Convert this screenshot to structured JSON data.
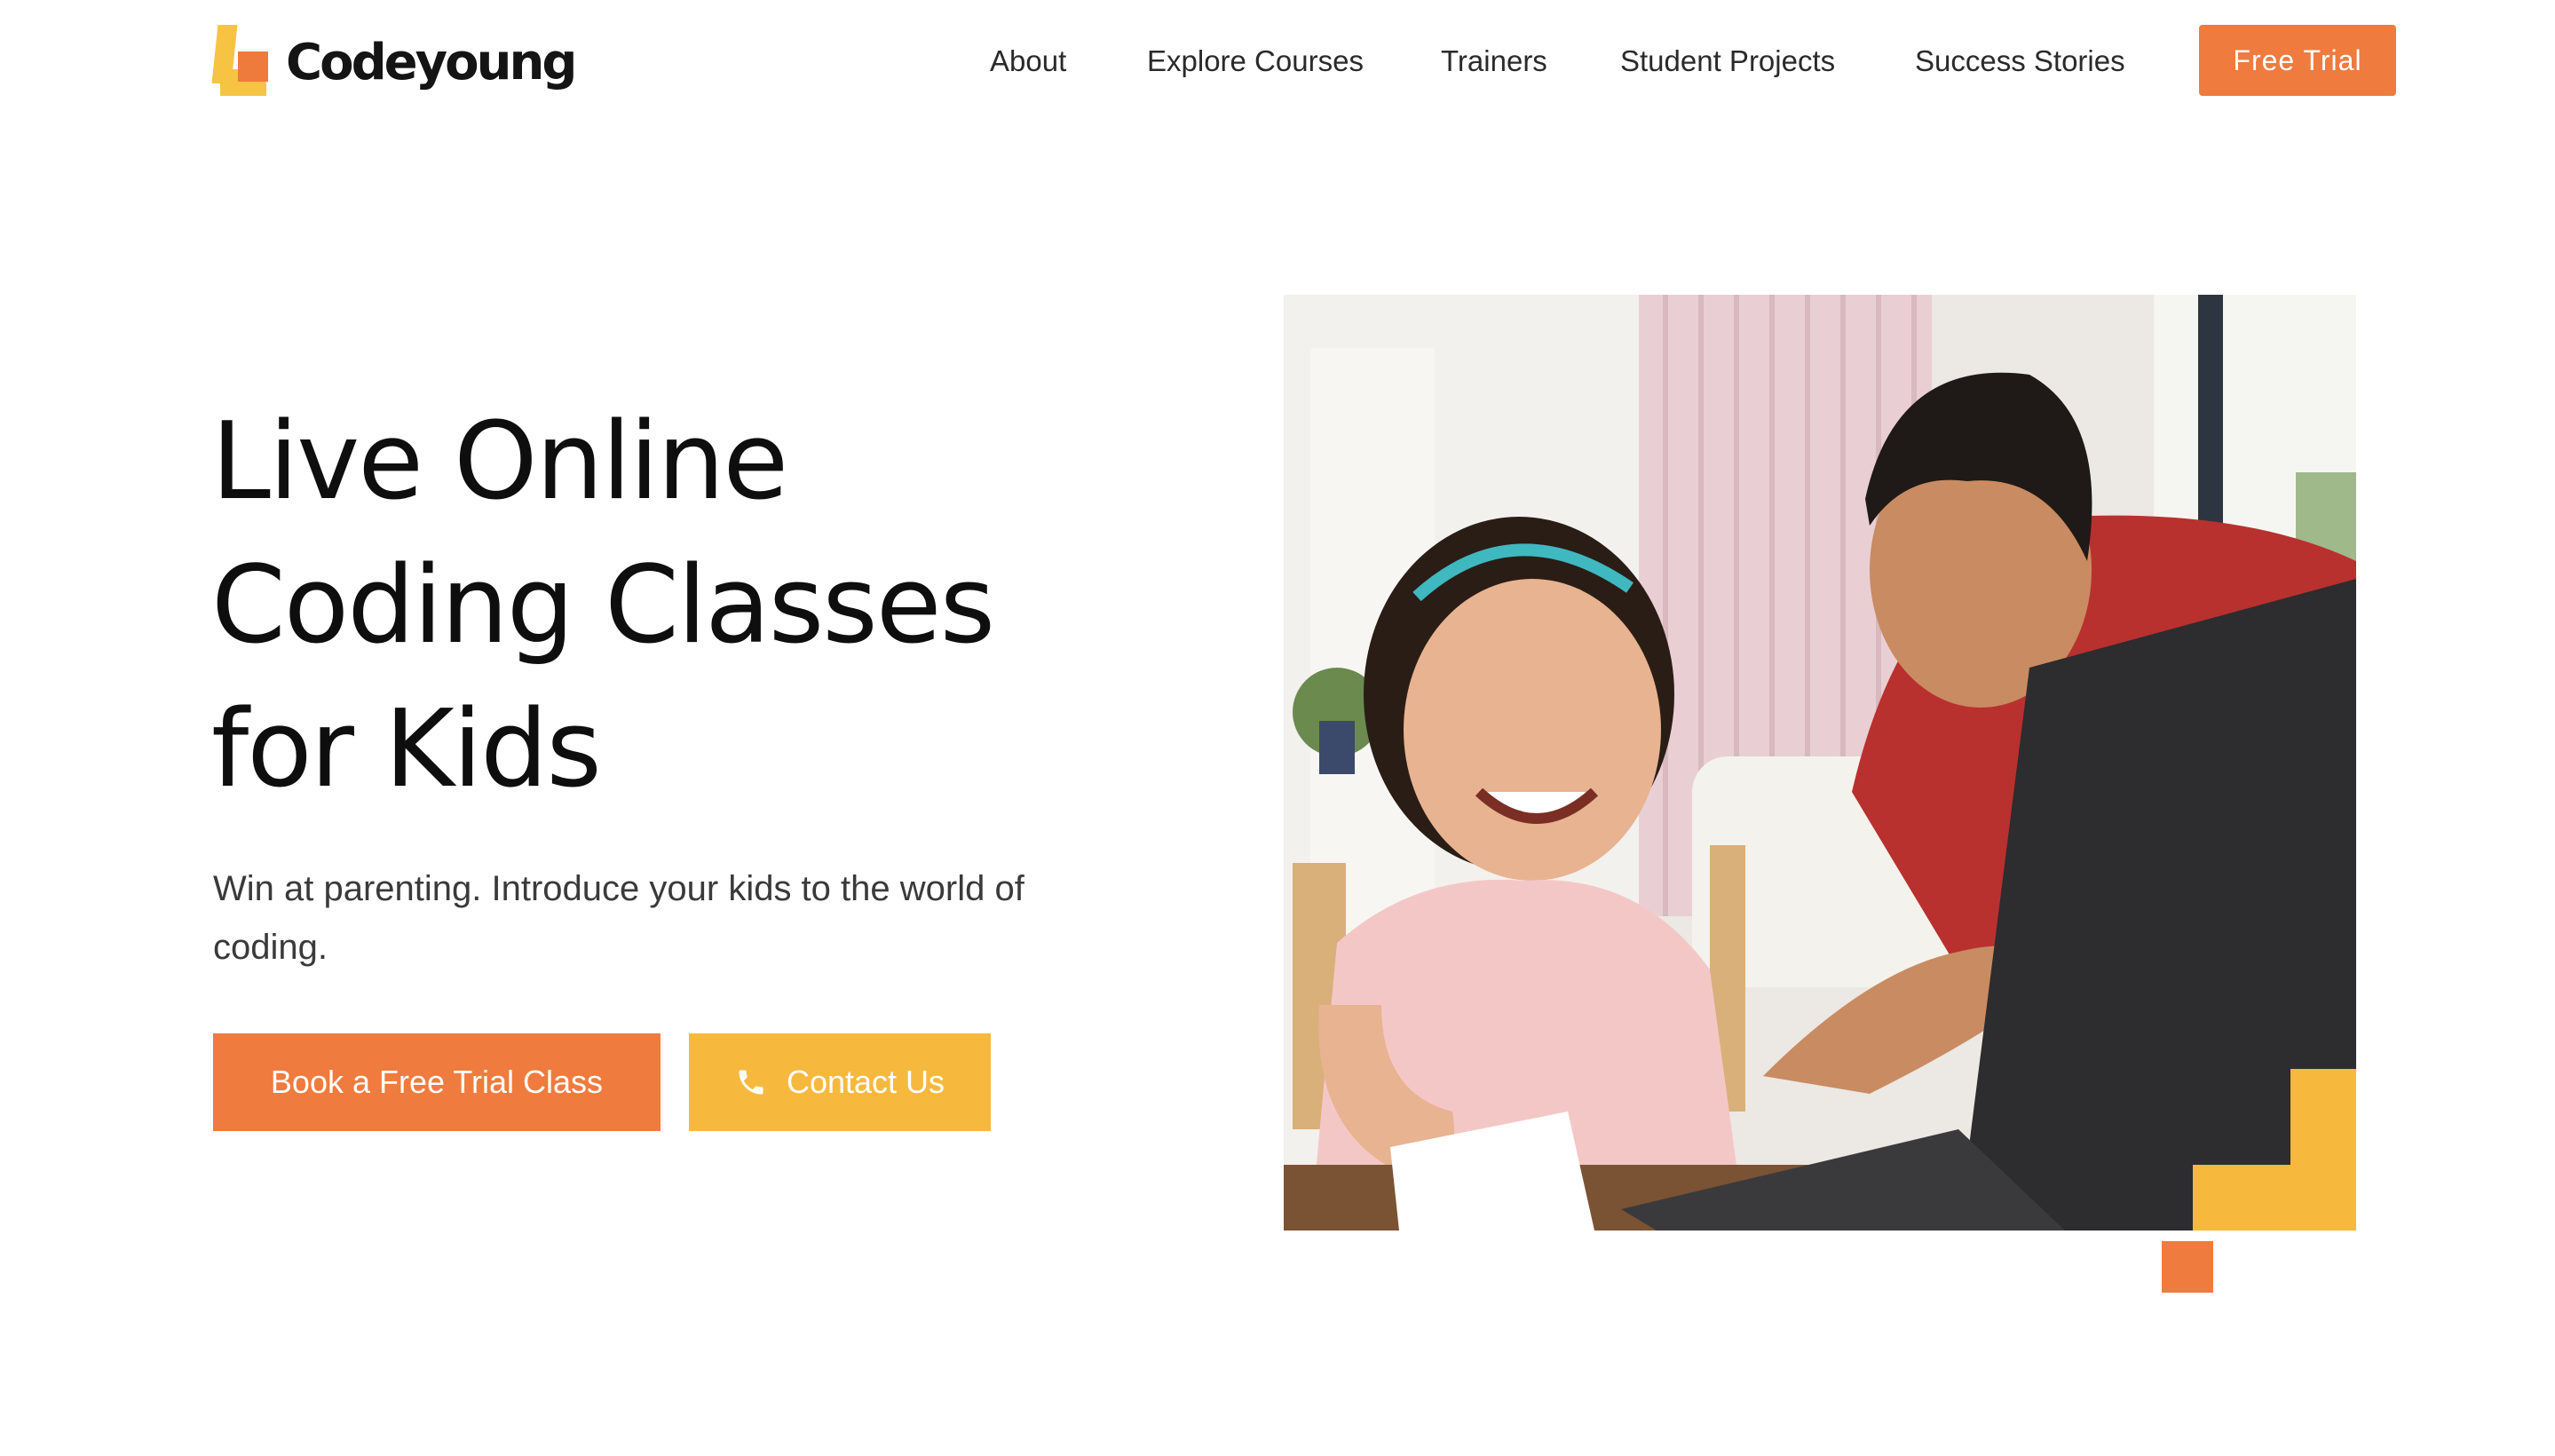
{
  "brand": {
    "name": "Codeyoung",
    "colors": {
      "orange": "#ef7b3e",
      "yellow": "#f6b93e",
      "text": "#0e0e0e"
    }
  },
  "nav": {
    "items": [
      {
        "label": "About"
      },
      {
        "label": "Explore Courses"
      },
      {
        "label": "Trainers"
      },
      {
        "label": "Student Projects"
      },
      {
        "label": "Success Stories"
      }
    ],
    "cta_label": "Free Trial"
  },
  "hero": {
    "title_lines": [
      "Live Online",
      "Coding Classes",
      "for Kids"
    ],
    "subtitle": "Win at parenting. Introduce your kids to the world of coding.",
    "primary_cta": "Book a Free Trial Class",
    "secondary_cta": "Contact Us",
    "secondary_cta_icon": "phone-icon",
    "image_alt": "girl-and-man-at-laptop-photo"
  }
}
